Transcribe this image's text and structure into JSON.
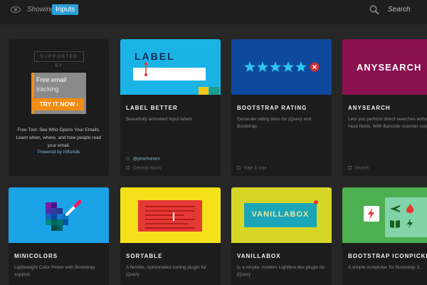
{
  "topbar": {
    "showing_label": "Showing",
    "filter_value": "Inputs",
    "search_label": "Search"
  },
  "ad": {
    "supported_by": "SUPPORTED BY",
    "banner_line1": "Free email",
    "banner_line2": "tracking",
    "banner_cta": "TRY IT NOW",
    "text": "Free Tool: See Who Opens Your Emails. Learn when, where, and how people read your email.",
    "powered_by": "Powered by InfluAds"
  },
  "cards": [
    {
      "title": "LABEL BETTER",
      "description": "Beautifully animated input labels",
      "author": "@peachananr",
      "category": "General Inputs",
      "thumb_color": "#1ab3e6",
      "thumb_text": "LABEL"
    },
    {
      "title": "BOOTSTRAP RATING",
      "description": "Generate rating stars for jQuery and Bootstrap.",
      "category": "Rate & Vote",
      "thumb_color": "#0d4a9e"
    },
    {
      "title": "ANYSEARCH",
      "description": "Lets you perform direct searches without any input fields. With Barcode scanner support.",
      "category": "Search",
      "thumb_color": "#8b1151",
      "thumb_text": "ANYSEARCH"
    },
    {
      "title": "MINICOLORS",
      "description": "Lightweight Color Picker with Bootstrap support.",
      "thumb_color": "#1ba3e8"
    },
    {
      "title": "SORTABLE",
      "description": "A flexible, opinionated sorting plugin for jQuery",
      "thumb_color": "#f5e11a"
    },
    {
      "title": "VANILLABOX",
      "description": "Is a simple, modern Lightbox-like plugin for jQuery",
      "thumb_color": "#d6d627",
      "thumb_text": "VANILLABOX"
    },
    {
      "title": "BOOTSTRAP ICONPICKER",
      "description": "A simple iconpicker for Bootstrap 3.",
      "thumb_color": "#4caf50"
    }
  ],
  "colors": {
    "accent": "#2a9fd6",
    "background": "#262626",
    "card": "#1c1c1c",
    "ad_orange": "#f28c13"
  },
  "icons": [
    "eye-icon",
    "search-icon",
    "user-icon",
    "tag-icon",
    "star-icon",
    "close-icon",
    "lightning-icon",
    "plane-icon",
    "flame-icon",
    "book-icon"
  ]
}
